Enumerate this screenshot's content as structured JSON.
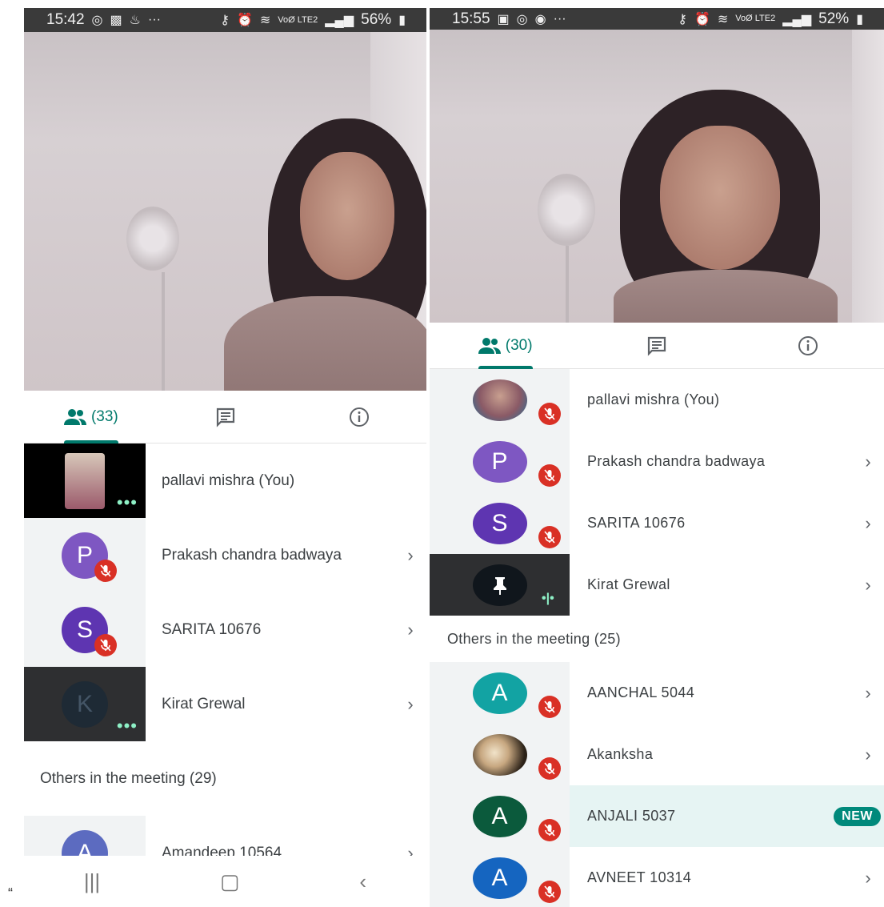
{
  "left": {
    "status": {
      "time": "15:42",
      "battery": "56%",
      "lte": "VoØ LTE2"
    },
    "tabs": {
      "people_count": "(33)"
    },
    "participants": [
      {
        "name": "pallavi mishra (You)",
        "initial": "",
        "color": "",
        "muted": false
      },
      {
        "name": "Prakash chandra badwaya",
        "initial": "P",
        "color": "#7e57c2",
        "muted": true
      },
      {
        "name": "SARITA 10676",
        "initial": "S",
        "color": "#5e35b1",
        "muted": true
      },
      {
        "name": "Kirat Grewal",
        "initial": "K",
        "color": "#1e2a35",
        "muted": false
      }
    ],
    "others_label": "Others in the meeting (29)",
    "others": [
      {
        "name": "Amandeep 10564",
        "initial": "A",
        "color": "#5c6bc0",
        "muted": true
      }
    ]
  },
  "right": {
    "status": {
      "time": "15:55",
      "battery": "52%",
      "lte": "VoØ LTE2"
    },
    "tabs": {
      "people_count": "(30)"
    },
    "participants": [
      {
        "name": "pallavi mishra (You)",
        "initial": "",
        "color": "",
        "muted": true
      },
      {
        "name": "Prakash chandra badwaya",
        "initial": "P",
        "color": "#7e57c2",
        "muted": true
      },
      {
        "name": "SARITA 10676",
        "initial": "S",
        "color": "#5e35b1",
        "muted": true
      },
      {
        "name": "Kirat Grewal",
        "initial": "",
        "color": "#10161c",
        "muted": false
      }
    ],
    "others_label": "Others in the meeting (25)",
    "others": [
      {
        "name": "AANCHAL 5044",
        "initial": "A",
        "color": "#12a3a3",
        "muted": true
      },
      {
        "name": "Akanksha",
        "initial": "",
        "color": "",
        "muted": true
      },
      {
        "name": "ANJALI 5037",
        "initial": "A",
        "color": "#0b5a3c",
        "muted": true,
        "badge": "NEW"
      },
      {
        "name": "AVNEET 10314",
        "initial": "A",
        "color": "#1565c0",
        "muted": true
      }
    ]
  },
  "footer_mark": "“",
  "icons": [
    "whatsapp-icon",
    "gallery-icon",
    "key-icon",
    "alarm-icon",
    "wifi-icon",
    "signal-icon",
    "battery-icon",
    "people-icon",
    "chat-icon",
    "info-icon",
    "mic-off-icon",
    "chevron-right-icon",
    "pin-icon",
    "more-dots-icon",
    "audio-level-icon",
    "nav-recent-icon",
    "nav-home-icon",
    "nav-back-icon"
  ]
}
